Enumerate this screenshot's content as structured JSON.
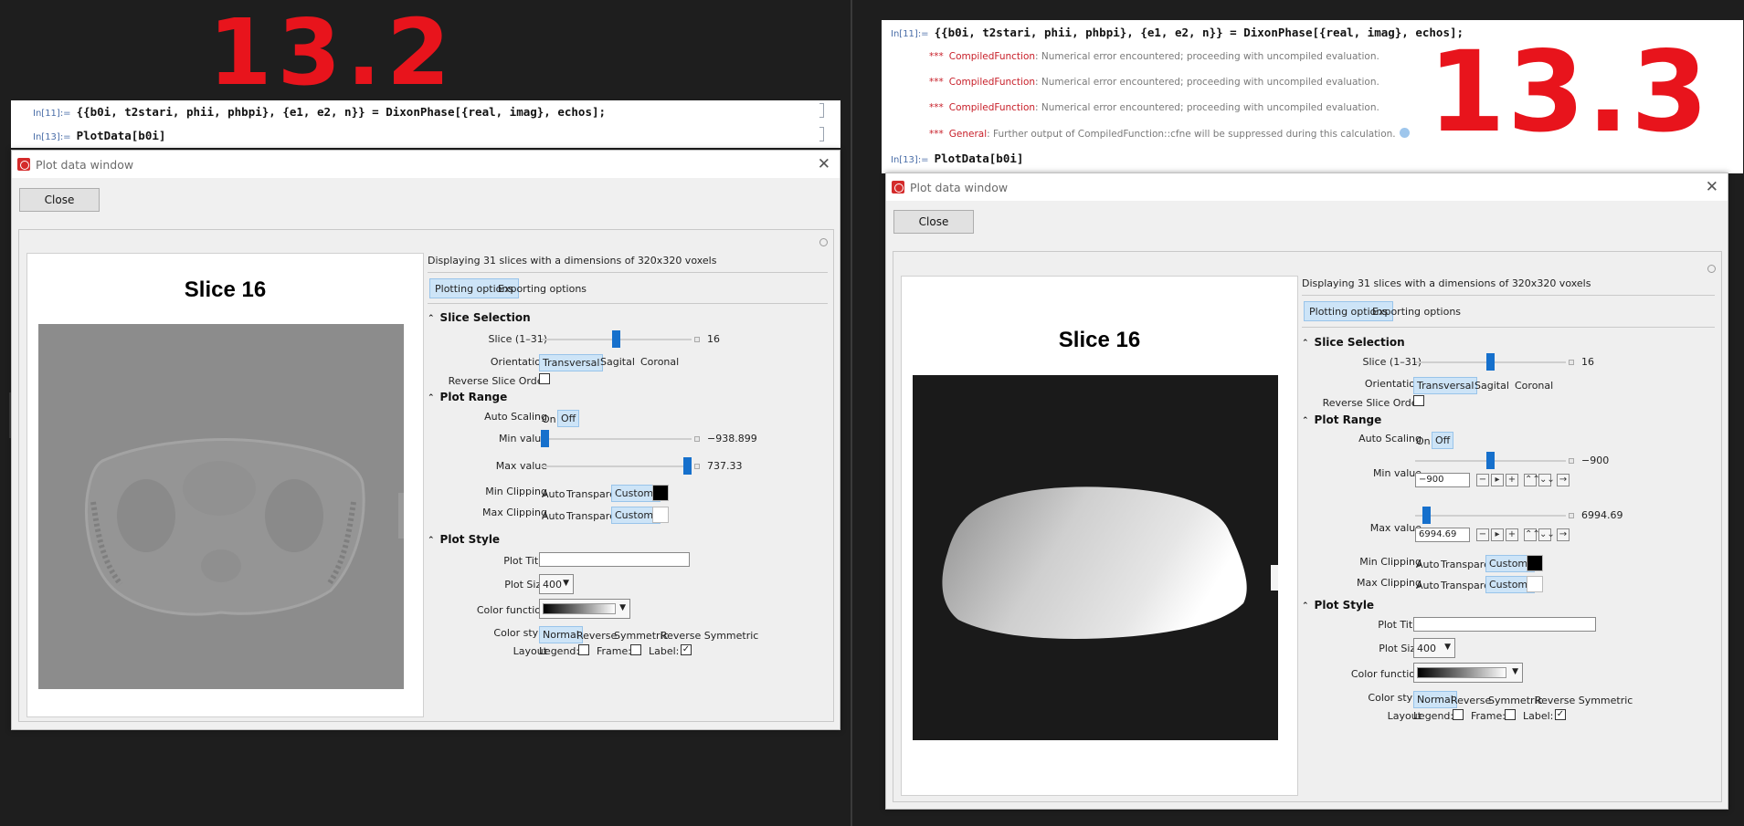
{
  "left": {
    "version_label": "13.2",
    "cells": [
      {
        "label": "In[11]:=",
        "code": "{{b0i, t2stari, phii, phbpi}, {e1, e2, n}} = DixonPhase[{real, imag}, echos];"
      },
      {
        "label": "In[13]:=",
        "code": "PlotData[b0i]"
      }
    ],
    "window": {
      "title": "Plot data window",
      "close_button": "Close",
      "slice_title": "Slice 16",
      "info": "Displaying 31 slices with a dimensions of 320x320 voxels",
      "tabs": [
        "Plotting options",
        "Exporting options"
      ],
      "slice_selection": {
        "header": "Slice Selection",
        "slice_label": "Slice (1–31)",
        "slice_value": "16",
        "slice_fraction": 0.5,
        "orientation_label": "Orientation",
        "orientation_options": [
          "Transversal",
          "Sagital",
          "Coronal"
        ],
        "reverse_label": "Reverse Slice Order"
      },
      "plot_range": {
        "header": "Plot Range",
        "auto_scaling_label": "Auto Scaling",
        "auto_options": [
          "On",
          "Off"
        ],
        "min_label": "Min value",
        "min_value": "−938.899",
        "min_fraction": 0.0,
        "max_label": "Max value",
        "max_value": "737.33",
        "max_fraction": 1.0,
        "min_clip_label": "Min Clipping",
        "max_clip_label": "Max Clipping",
        "clip_options": [
          "Auto",
          "Transparent",
          "Custom:"
        ]
      },
      "plot_style": {
        "header": "Plot Style",
        "title_label": "Plot Title",
        "size_label": "Plot Size",
        "size_value": "400",
        "color_function_label": "Color function",
        "color_style_label": "Color style",
        "color_style_options": [
          "Normal",
          "Reverse",
          "Symmetric",
          "Reverse Symmetric"
        ],
        "layout_label": "Layout",
        "legend_label": "Legend:",
        "frame_label": "Frame:",
        "label_label": "Label:"
      }
    }
  },
  "right": {
    "version_label": "13.3",
    "cells": [
      {
        "label": "In[11]:=",
        "code": "{{b0i, t2stari, phii, phbpi}, {e1, e2, n}} = DixonPhase[{real, imag}, echos];"
      },
      {
        "label": "In[13]:=",
        "code": "PlotData[b0i]"
      }
    ],
    "messages": [
      {
        "stars": "***",
        "name": "CompiledFunction",
        "text": ": Numerical error encountered; proceeding with uncompiled evaluation."
      },
      {
        "stars": "***",
        "name": "CompiledFunction",
        "text": ": Numerical error encountered; proceeding with uncompiled evaluation."
      },
      {
        "stars": "***",
        "name": "CompiledFunction",
        "text": ": Numerical error encountered; proceeding with uncompiled evaluation."
      },
      {
        "stars": "***",
        "name": "General",
        "text": ": Further output of CompiledFunction::cfne will be suppressed during this calculation."
      }
    ],
    "window": {
      "title": "Plot data window",
      "close_button": "Close",
      "slice_title": "Slice 16",
      "info": "Displaying 31 slices with a dimensions of 320x320 voxels",
      "tabs": [
        "Plotting options",
        "Exporting options"
      ],
      "slice_selection": {
        "header": "Slice Selection",
        "slice_label": "Slice (1–31)",
        "slice_value": "16",
        "slice_fraction": 0.5,
        "orientation_label": "Orientation",
        "orientation_options": [
          "Transversal",
          "Sagital",
          "Coronal"
        ],
        "reverse_label": "Reverse Slice Order"
      },
      "plot_range": {
        "header": "Plot Range",
        "auto_scaling_label": "Auto Scaling",
        "auto_options": [
          "On",
          "Off"
        ],
        "min_label": "Min value",
        "min_value": "−900",
        "min_input": "−900",
        "min_fraction": 0.5,
        "max_label": "Max value",
        "max_value": "6994.69",
        "max_input": "6994.69",
        "max_fraction": 0.05,
        "min_clip_label": "Min Clipping",
        "max_clip_label": "Max Clipping",
        "clip_options": [
          "Auto",
          "Transparent",
          "Custom:"
        ],
        "stepper_icons": [
          "−",
          "▸",
          "+",
          "⌃⌃",
          "⌄⌄",
          "→"
        ]
      },
      "plot_style": {
        "header": "Plot Style",
        "title_label": "Plot Title",
        "size_label": "Plot Size",
        "size_value": "400",
        "color_function_label": "Color function",
        "color_style_label": "Color style",
        "color_style_options": [
          "Normal",
          "Reverse",
          "Symmetric",
          "Reverse Symmetric"
        ],
        "layout_label": "Layout",
        "legend_label": "Legend:",
        "frame_label": "Frame:",
        "label_label": "Label:"
      }
    }
  },
  "colors": {
    "accent": "#1670cc",
    "selected_bg": "#cde4f7",
    "annotation": "#e8141c"
  }
}
